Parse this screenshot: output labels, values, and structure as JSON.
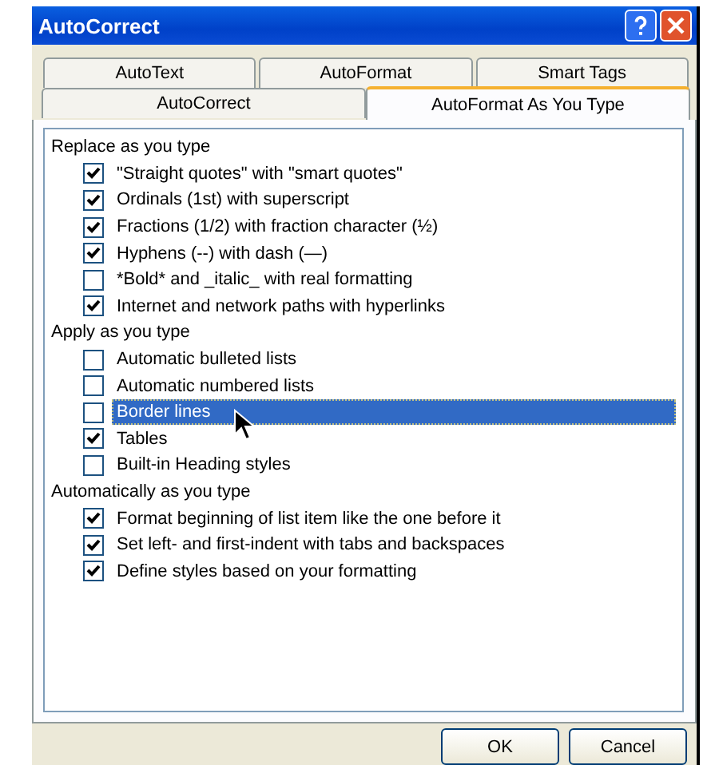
{
  "window": {
    "title": "AutoCorrect"
  },
  "tab_rows": [
    {
      "tabs": [
        {
          "label": "AutoText",
          "selected": false
        },
        {
          "label": "AutoFormat",
          "selected": false
        },
        {
          "label": "Smart Tags",
          "selected": false
        }
      ]
    },
    {
      "tabs": [
        {
          "label": "AutoCorrect",
          "selected": false
        },
        {
          "label": "AutoFormat As You Type",
          "selected": true
        }
      ]
    }
  ],
  "sections": [
    {
      "heading": "Replace as you type",
      "options": [
        {
          "label": "\"Straight quotes\" with \"smart quotes\"",
          "checked": true,
          "selected": false
        },
        {
          "label": "Ordinals (1st) with superscript",
          "checked": true,
          "selected": false
        },
        {
          "label": "Fractions (1/2) with fraction character (½)",
          "checked": true,
          "selected": false
        },
        {
          "label": "Hyphens (--) with dash (—)",
          "checked": true,
          "selected": false
        },
        {
          "label": "*Bold* and _italic_ with real formatting",
          "checked": false,
          "selected": false
        },
        {
          "label": "Internet and network paths with hyperlinks",
          "checked": true,
          "selected": false
        }
      ]
    },
    {
      "heading": "Apply as you type",
      "options": [
        {
          "label": "Automatic bulleted lists",
          "checked": false,
          "selected": false
        },
        {
          "label": "Automatic numbered lists",
          "checked": false,
          "selected": false
        },
        {
          "label": "Border lines",
          "checked": false,
          "selected": true
        },
        {
          "label": "Tables",
          "checked": true,
          "selected": false
        },
        {
          "label": "Built-in Heading styles",
          "checked": false,
          "selected": false
        }
      ]
    },
    {
      "heading": "Automatically as you type",
      "options": [
        {
          "label": "Format beginning of list item like the one before it",
          "checked": true,
          "selected": false
        },
        {
          "label": "Set left- and first-indent with tabs and backspaces",
          "checked": true,
          "selected": false
        },
        {
          "label": "Define styles based on your formatting",
          "checked": true,
          "selected": false
        }
      ]
    }
  ],
  "buttons": [
    "OK",
    "Cancel"
  ]
}
